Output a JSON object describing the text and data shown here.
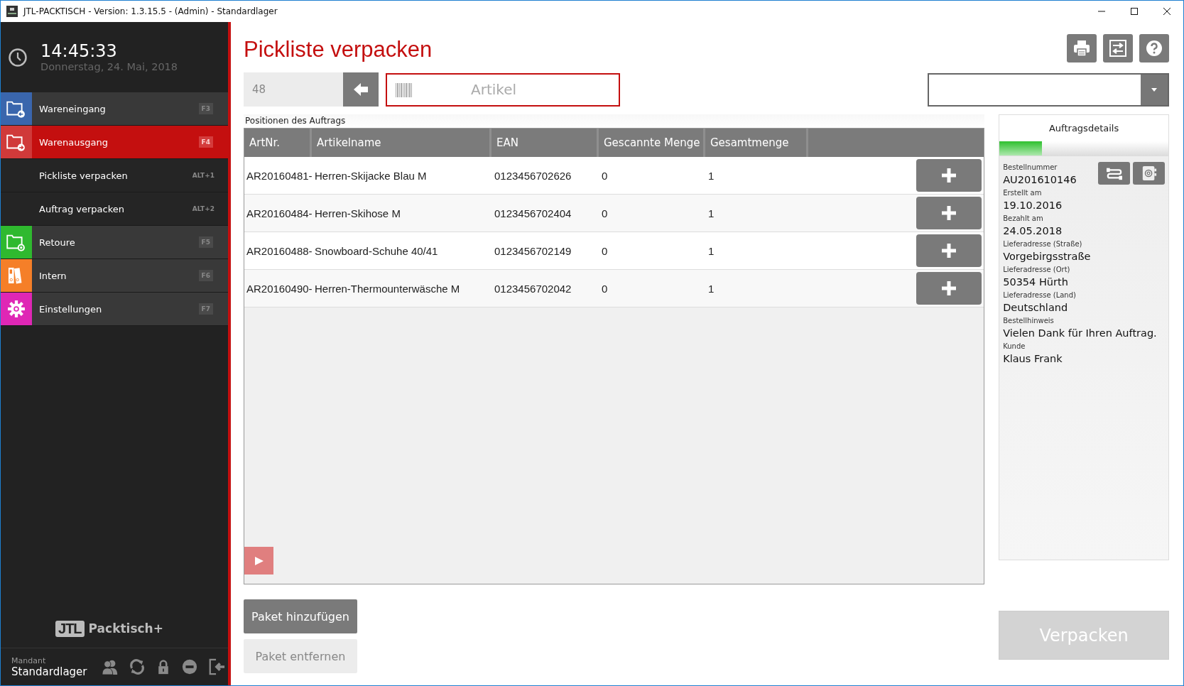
{
  "window": {
    "title": "JTL-PACKTISCH - Version: 1.3.15.5 - (Admin) - Standardlager"
  },
  "sidebar": {
    "clock": {
      "time": "14:45:33",
      "date": "Donnerstag, 24. Mai, 2018"
    },
    "nav": [
      {
        "kind": "section",
        "label": "Wareneingang",
        "shortcut": "F3",
        "color": "#3a66ad",
        "selected": false
      },
      {
        "kind": "section",
        "label": "Warenausgang",
        "shortcut": "F4",
        "color": "#d03a3a",
        "selected": true
      },
      {
        "kind": "sub",
        "label": "Pickliste verpacken",
        "shortcut": "ALT+1",
        "selected": false
      },
      {
        "kind": "sub",
        "label": "Auftrag verpacken",
        "shortcut": "ALT+2",
        "selected": false
      },
      {
        "kind": "section",
        "label": "Retoure",
        "shortcut": "F5",
        "color": "#2fb92f",
        "selected": false
      },
      {
        "kind": "section",
        "label": "Intern",
        "shortcut": "F6",
        "color": "#f57f28",
        "selected": false
      },
      {
        "kind": "section",
        "label": "Einstellungen",
        "shortcut": "F7",
        "color": "#df27b5",
        "selected": false
      }
    ],
    "logo": {
      "mark": "JTL",
      "text": "Packtisch+"
    },
    "footer": {
      "label": "Mandant",
      "value": "Standardlager"
    }
  },
  "main": {
    "title": "Pickliste verpacken",
    "order_field": {
      "value": "48",
      "disabled": true
    },
    "article_field": {
      "placeholder": "Artikel"
    },
    "table": {
      "caption": "Positionen des Auftrags",
      "columns": [
        "ArtNr.",
        "Artikelname",
        "EAN",
        "Gescannte Menge",
        "Gesamtmenge"
      ],
      "rows": [
        {
          "cells": [
            "AR20160481-",
            "Herren-Skijacke Blau M",
            "0123456702626",
            "0",
            "1"
          ]
        },
        {
          "cells": [
            "AR20160484-",
            "Herren-Skihose M",
            "0123456702404",
            "0",
            "1"
          ]
        },
        {
          "cells": [
            "AR20160488-",
            "Snowboard-Schuhe 40/41",
            "0123456702149",
            "0",
            "1"
          ]
        },
        {
          "cells": [
            "AR20160490-",
            "Herren-Thermounterwäsche M",
            "0123456702042",
            "0",
            "1"
          ]
        }
      ]
    },
    "add_package": {
      "label": "Paket hinzufügen",
      "disabled": false
    },
    "remove_package": {
      "label": "Paket entfernen",
      "disabled": true
    },
    "details": {
      "title": "Auftragsdetails",
      "progress": {
        "level": 0.25
      },
      "fields": [
        {
          "label": "Bestellnummer",
          "value": "AU201610146"
        },
        {
          "label": "Erstellt am",
          "value": "19.10.2016"
        },
        {
          "label": "Bezahlt am",
          "value": "24.05.2018"
        },
        {
          "label": "Lieferadresse (Straße)",
          "value": "Vorgebirgsstraße"
        },
        {
          "label": "Lieferadresse (Ort)",
          "value": "50354 Hürth"
        },
        {
          "label": "Lieferadresse (Land)",
          "value": "Deutschland"
        },
        {
          "label": "Bestellhinweis",
          "value": "Vielen Dank für Ihren Auftrag."
        },
        {
          "label": "Kunde",
          "value": "Klaus Frank"
        }
      ]
    },
    "pack": {
      "label": "Verpacken",
      "disabled": true
    }
  }
}
